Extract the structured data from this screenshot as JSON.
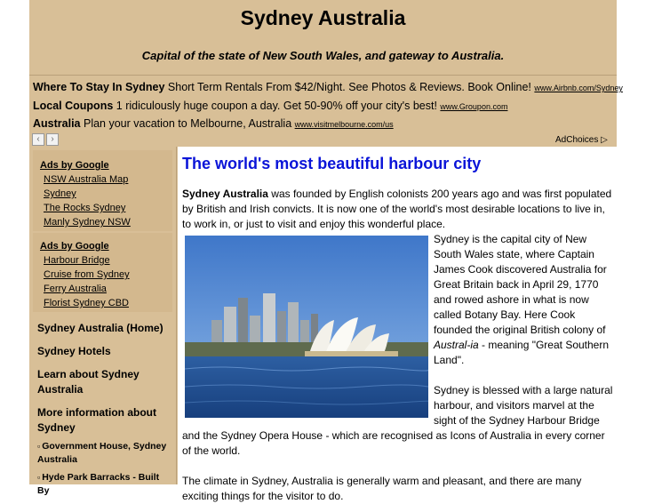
{
  "header": {
    "title": "Sydney Australia",
    "tagline": "Capital of the state of New South Wales, and gateway to Australia."
  },
  "ads_top": [
    {
      "title": "Where To Stay In Sydney",
      "text": "Short Term Rentals From $42/Night. See Photos & Reviews. Book Online!",
      "url": "www.Airbnb.com/Sydney"
    },
    {
      "title": "Local Coupons",
      "text": "1 ridiculously huge coupon a day. Get 50-90% off your city's best!",
      "url": "www.Groupon.com"
    },
    {
      "title": "Australia",
      "text": "Plan your vacation to Melbourne, Australia",
      "url": "www.visitmelbourne.com/us"
    }
  ],
  "ad_nav": {
    "prev": "‹",
    "next": "›"
  },
  "adchoices": "AdChoices ▷",
  "sidebar": {
    "ads1": {
      "head": "Ads by Google",
      "links": [
        "NSW Australia Map",
        "Sydney",
        "The Rocks Sydney",
        "Manly Sydney NSW"
      ]
    },
    "ads2": {
      "head": "Ads by Google",
      "links": [
        "Harbour Bridge",
        "Cruise from Sydney",
        "Ferry Australia",
        "Florist Sydney CBD"
      ]
    },
    "nav": [
      "Sydney Australia (Home)",
      "Sydney Hotels",
      "Learn about Sydney Australia",
      "More information about Sydney"
    ],
    "sub": [
      "Government House, Sydney Australia",
      "Hyde Park Barracks - Built By"
    ]
  },
  "content": {
    "heading": "The world's most beautiful harbour city",
    "intro_bold": "Sydney Australia",
    "intro_rest": " was founded by English colonists 200 years ago and was first populated by British and Irish convicts. It is now one of the world's most desirable locations to live in, to work in, or just to visit and enjoy this wonderful place.",
    "p2_a": "Sydney is the capital city of New South Wales state, where Captain James Cook discovered Australia for Great Britain back in April 29, 1770 and rowed ashore in what is now called Botany Bay. Here Cook founded the original British colony of ",
    "p2_italic": "Austral-ia",
    "p2_b": " - meaning \"Great Southern Land\".",
    "p3": "Sydney is blessed with a large natural harbour, and visitors marvel at the sight of the Sydney Harbour Bridge and the Sydney Opera House - which are recognised as Icons of Australia in every corner of the world.",
    "p4": "The climate in Sydney, Australia is generally warm and pleasant, and there are many exciting things for the visitor to do."
  }
}
